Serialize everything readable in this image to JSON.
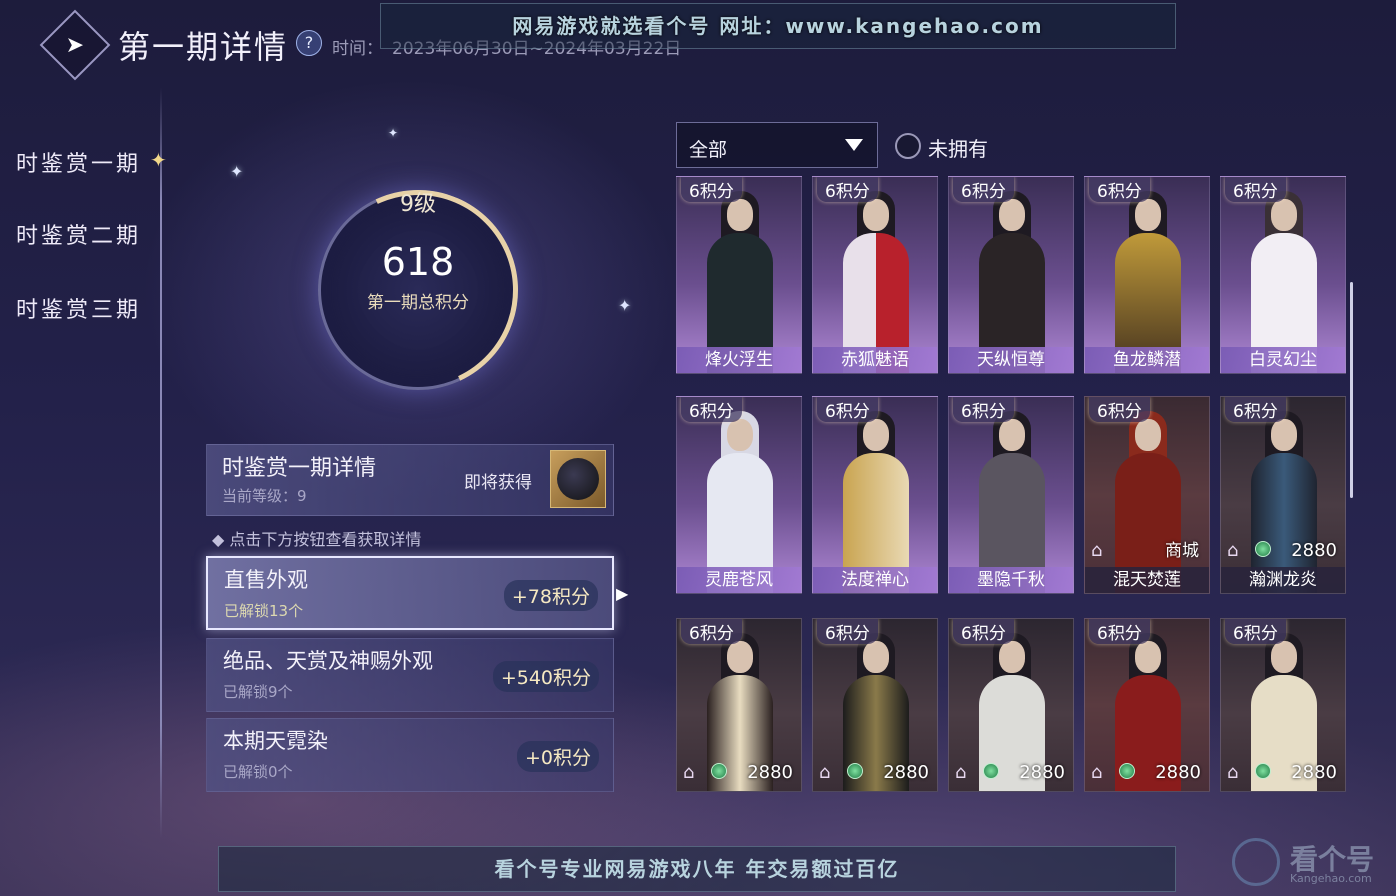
{
  "header": {
    "back_icon": "back-arrow-icon",
    "title": "第一期详情",
    "help": "?",
    "time_label": "时间：",
    "time_value": "2023年06月30日~2024年03月22日"
  },
  "watermark_top": "网易游戏就选看个号  网址：www.kangehao.com",
  "nav": {
    "items": [
      "时鉴赏一期",
      "时鉴赏二期",
      "时鉴赏三期"
    ],
    "active": 0
  },
  "level": {
    "level_text": "9级",
    "points": "618",
    "points_label": "第一期总积分"
  },
  "detail": {
    "title": "时鉴赏一期详情",
    "current_level": "当前等级：9",
    "soon_label": "即将获得"
  },
  "hint": "点击下方按钮查看获取详情",
  "categories": [
    {
      "name": "直售外观",
      "unlocked": "已解锁13个",
      "points": "+78积分",
      "active": true
    },
    {
      "name": "绝品、天赏及神赐外观",
      "unlocked": "已解锁9个",
      "points": "+540积分"
    },
    {
      "name": "本期天霓染",
      "unlocked": "已解锁0个",
      "points": "+0积分"
    }
  ],
  "filter": {
    "selected": "全部",
    "not_owned_label": "未拥有"
  },
  "items": [
    {
      "badge": "6积分",
      "name": "烽火浮生"
    },
    {
      "badge": "6积分",
      "name": "赤狐魅语"
    },
    {
      "badge": "6积分",
      "name": "天纵恒尊"
    },
    {
      "badge": "6积分",
      "name": "鱼龙鳞潜"
    },
    {
      "badge": "6积分",
      "name": "白灵幻尘"
    },
    {
      "badge": "6积分",
      "name": "灵鹿苍风"
    },
    {
      "badge": "6积分",
      "name": "法度禅心"
    },
    {
      "badge": "6积分",
      "name": "墨隐千秋"
    },
    {
      "badge": "6积分",
      "name": "混天焚莲",
      "tag": "商城"
    },
    {
      "badge": "6积分",
      "name": "瀚渊龙炎",
      "price": "2880"
    },
    {
      "badge": "6积分",
      "price": "2880"
    },
    {
      "badge": "6积分",
      "price": "2880"
    },
    {
      "badge": "6积分",
      "price": "2880"
    },
    {
      "badge": "6积分",
      "price": "2880"
    },
    {
      "badge": "6积分",
      "price": "2880"
    }
  ],
  "watermark_bottom": "看个号专业网易游戏八年  年交易额过百亿",
  "watermark_brand": {
    "name": "看个号",
    "url": "Kangehao.com"
  }
}
